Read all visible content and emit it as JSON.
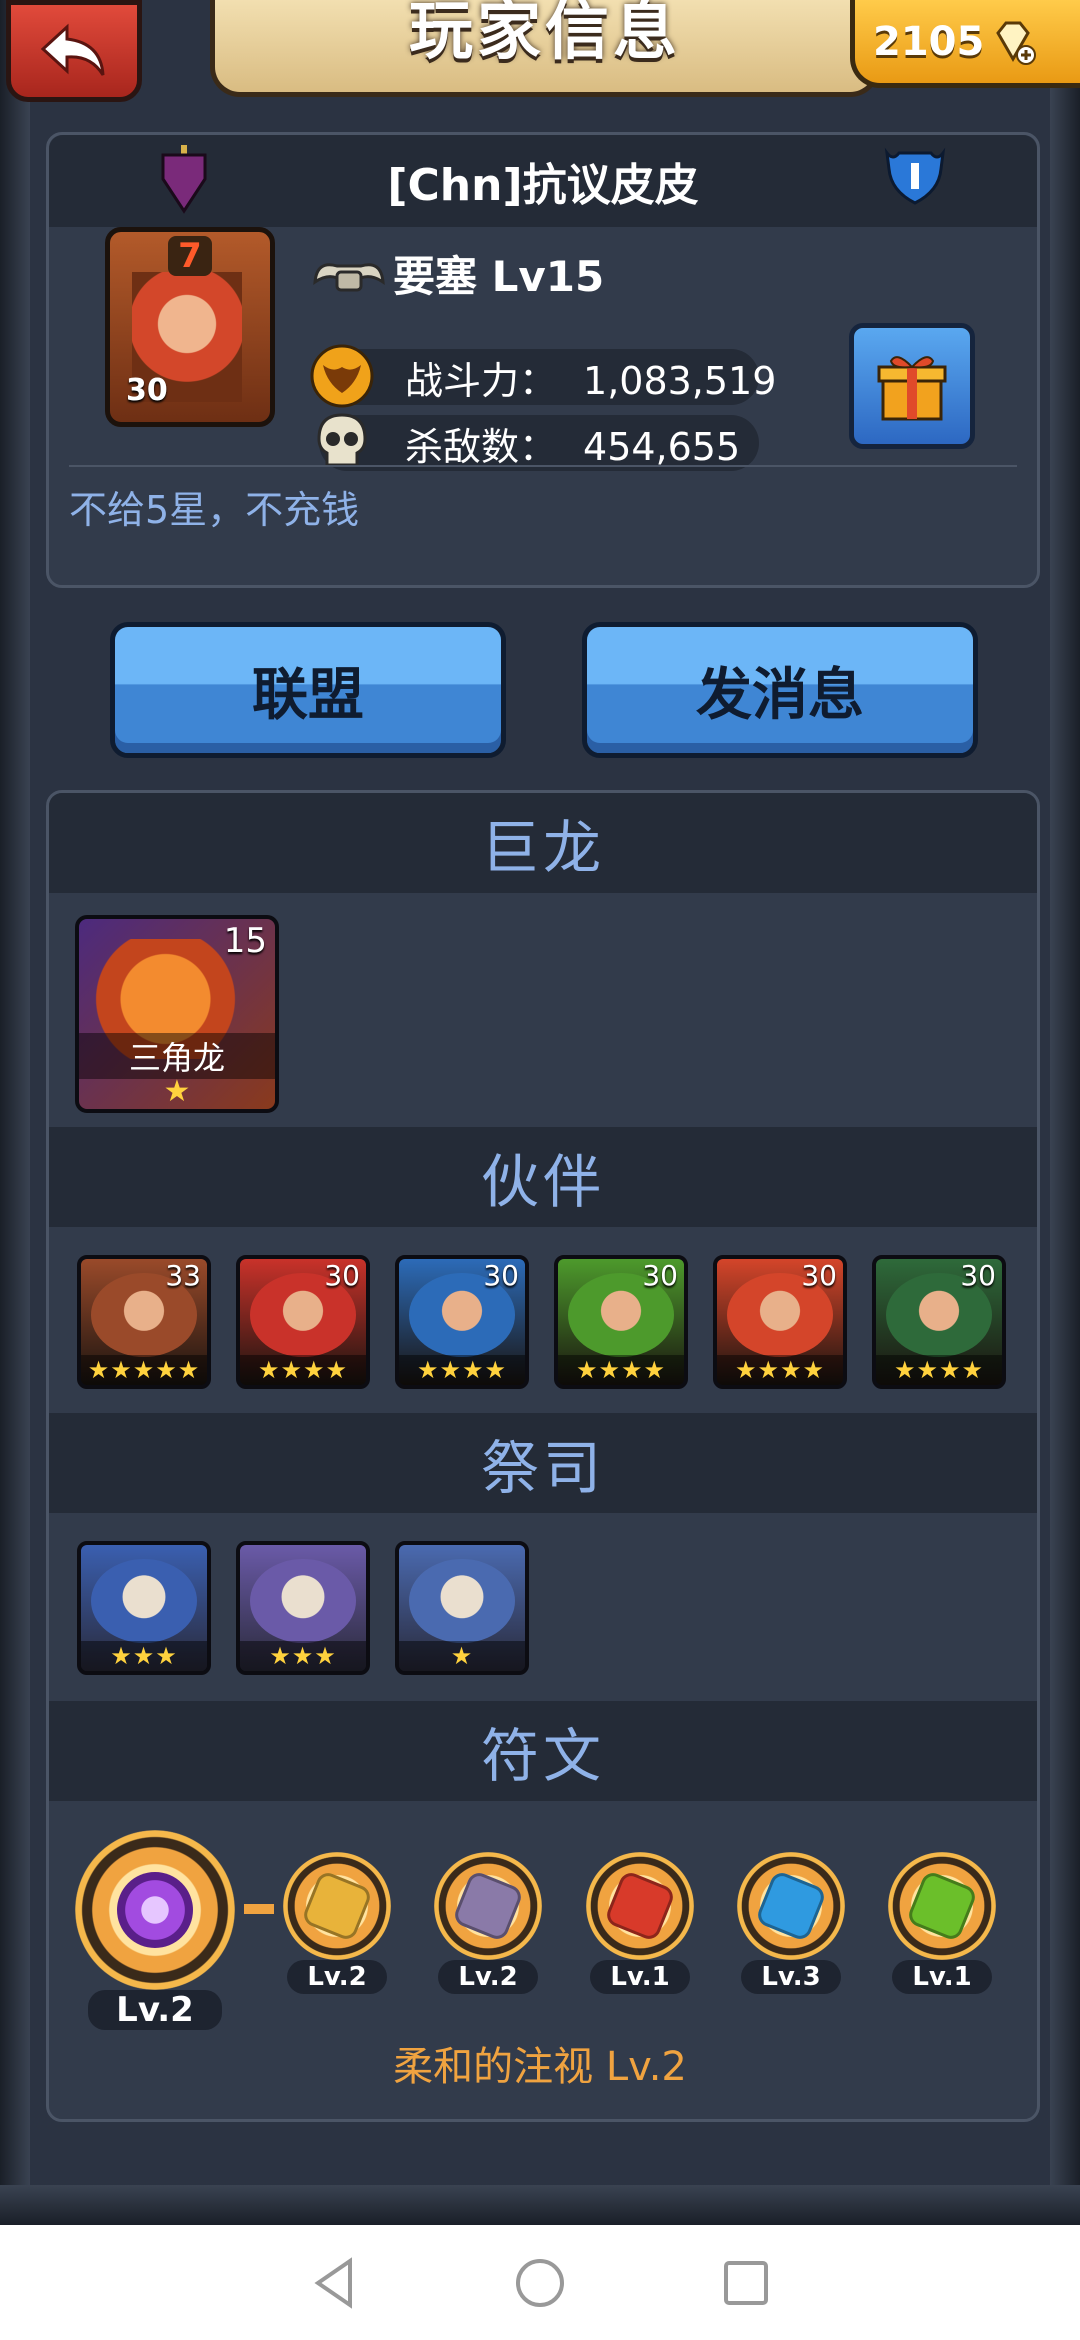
{
  "header": {
    "title": "玩家信息",
    "gem_count": "2105"
  },
  "profile": {
    "player_name": "[Chn]抗议皮皮",
    "avatar_rank": "7",
    "avatar_level": "30",
    "fortress_label": "要塞 Lv15",
    "power_label": "战斗力：",
    "power_value": "1,083,519",
    "kills_label": "杀敌数：",
    "kills_value": "454,655",
    "motto": "不给5星，不充钱"
  },
  "actions": {
    "alliance_label": "联盟",
    "message_label": "发消息"
  },
  "sections": {
    "dragon": {
      "title": "巨龙",
      "card": {
        "level": "15",
        "name": "三角龙",
        "stars": "★"
      }
    },
    "partners": {
      "title": "伙伴",
      "items": [
        {
          "level": "33",
          "stars": "★★★★★",
          "color": "#9a4a2a"
        },
        {
          "level": "30",
          "stars": "★★★★",
          "color": "#c9322a"
        },
        {
          "level": "30",
          "stars": "★★★★",
          "color": "#2c6bb8"
        },
        {
          "level": "30",
          "stars": "★★★★",
          "color": "#4d9a2c"
        },
        {
          "level": "30",
          "stars": "★★★★",
          "color": "#d4452a"
        },
        {
          "level": "30",
          "stars": "★★★★",
          "color": "#2e6a3a"
        }
      ]
    },
    "priests": {
      "title": "祭司",
      "items": [
        {
          "stars": "★★★",
          "color": "#3a5fb0"
        },
        {
          "stars": "★★★",
          "color": "#6a5aa8"
        },
        {
          "stars": "★",
          "color": "#4a6ab0"
        }
      ]
    },
    "runes": {
      "title": "符文",
      "main": {
        "level": "Lv.2",
        "color": "#a24be0"
      },
      "items": [
        {
          "level": "Lv.2",
          "color": "#e8b33a"
        },
        {
          "level": "Lv.2",
          "color": "#8a7aa8"
        },
        {
          "level": "Lv.1",
          "color": "#d83a2a"
        },
        {
          "level": "Lv.3",
          "color": "#2f9ae0"
        },
        {
          "level": "Lv.1",
          "color": "#6bbf2a"
        }
      ],
      "description": "柔和的注视 Lv.2"
    }
  }
}
